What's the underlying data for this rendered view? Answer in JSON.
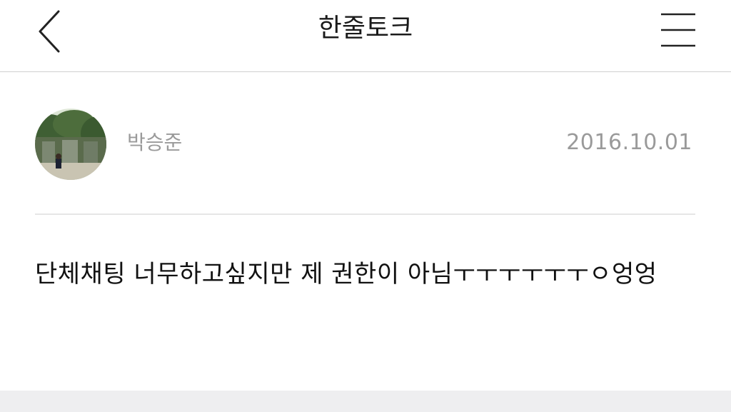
{
  "nav": {
    "title": "한줄토크",
    "back_icon": "chevron-left-icon",
    "menu_icon": "hamburger-menu-icon"
  },
  "post": {
    "author": "박승준",
    "date": "2016.10.01",
    "avatar_icon": "avatar-photo",
    "message": "단체채팅 너무하고싶지만 제 권한이 아님ㅜㅜㅜㅜㅜㅜㅇ엉엉"
  },
  "colors": {
    "background": "#ffffff",
    "meta_text": "#9a9a9a",
    "body_text": "#111111",
    "divider": "#e6e6e6",
    "footer_band": "#eeeef0"
  }
}
